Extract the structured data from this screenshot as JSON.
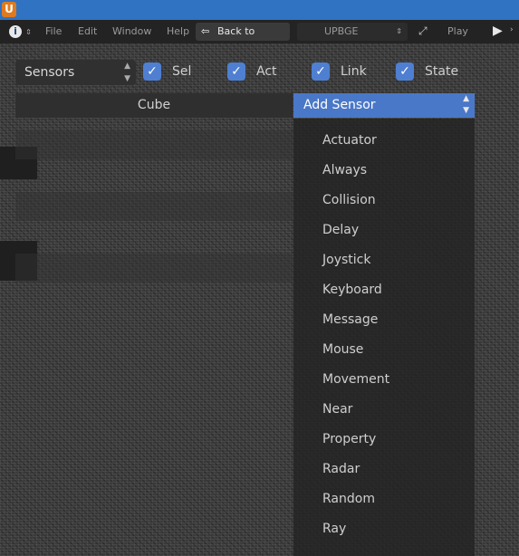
{
  "app": {
    "logo_glyph": "U"
  },
  "menubar": {
    "info_icon": "info-icon",
    "menu_items": [
      "File",
      "Edit",
      "Window",
      "Help"
    ],
    "back_button": "Back to Previous",
    "engine": "UPBGE",
    "play_label": "Play"
  },
  "header": {
    "sensor_type": "Sensors",
    "checkboxes": [
      {
        "label": "Sel",
        "checked": true
      },
      {
        "label": "Act",
        "checked": true
      },
      {
        "label": "Link",
        "checked": true
      },
      {
        "label": "State",
        "checked": true
      }
    ]
  },
  "object": {
    "name": "Cube"
  },
  "add_sensor": {
    "label": "Add Sensor",
    "options": [
      "Actuator",
      "Always",
      "Collision",
      "Delay",
      "Joystick",
      "Keyboard",
      "Message",
      "Mouse",
      "Movement",
      "Near",
      "Property",
      "Radar",
      "Random",
      "Ray"
    ]
  },
  "colors": {
    "titlebar": "#2f73c2",
    "accent": "#4a78c8",
    "checkbox": "#4f7fd1"
  }
}
